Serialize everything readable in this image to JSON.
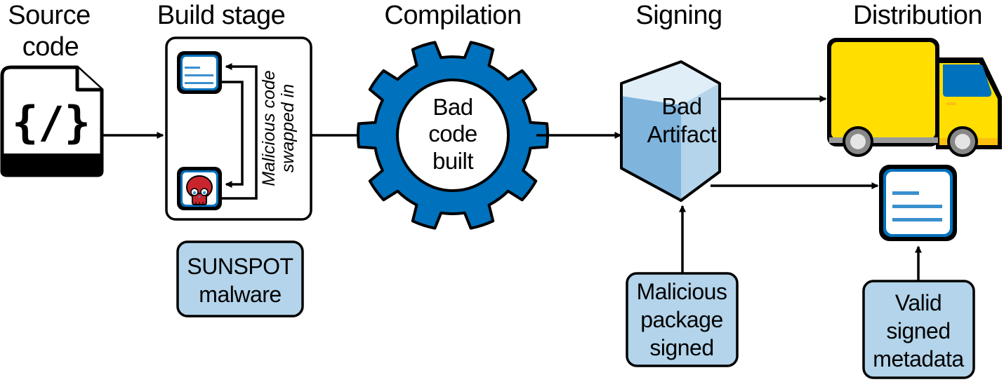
{
  "stages": {
    "source": {
      "title_line1": "Source",
      "title_line2": "code",
      "icon_glyph": "{/}"
    },
    "build": {
      "title": "Build stage",
      "swap_label_line1": "Malicious code",
      "swap_label_line2": "swapped in",
      "note_line1": "SUNSPOT",
      "note_line2": "malware"
    },
    "compilation": {
      "title": "Compilation",
      "gear_line1": "Bad",
      "gear_line2": "code",
      "gear_line3": "built"
    },
    "signing": {
      "title": "Signing",
      "artifact_line1": "Bad",
      "artifact_line2": "Artifact",
      "note_line1": "Malicious",
      "note_line2": "package",
      "note_line3": "signed"
    },
    "distribution": {
      "title": "Distribution",
      "note_line1": "Valid",
      "note_line2": "signed",
      "note_line3": "metadata"
    }
  },
  "colors": {
    "gear_blue": "#0071bc",
    "doc_border_blue": "#0071bc",
    "doc_line_blue": "#3a8fce",
    "note_fill": "#b3d4ea",
    "cube_top": "#e0eef8",
    "cube_left": "#7fb4dd",
    "cube_right": "#b3d4ea",
    "skull_red": "#c9252c",
    "truck_yellow": "#ffde00",
    "truck_bumper": "#fbbf10",
    "truck_window": "#0071bc",
    "wheel_gray": "#888888",
    "wheel_hub": "#e4e4e4",
    "chassis_gray": "#9a9a9a"
  }
}
